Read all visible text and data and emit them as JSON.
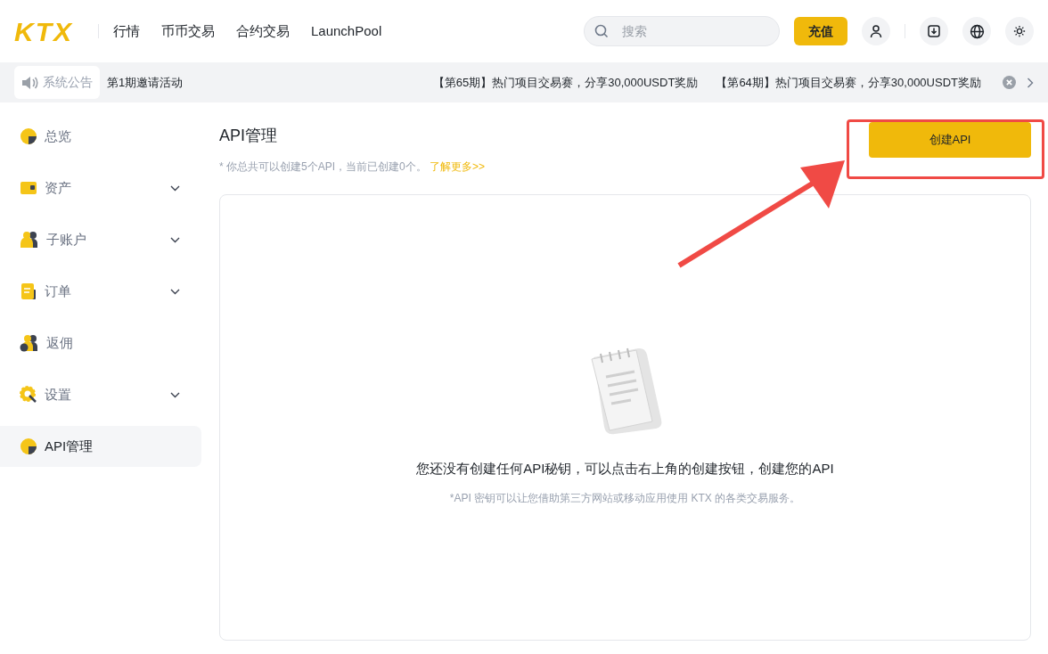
{
  "header": {
    "logo": "KTX",
    "nav": [
      "行情",
      "币币交易",
      "合约交易",
      "LaunchPool"
    ],
    "search": {
      "placeholder": "搜索"
    },
    "deposit_button": "充值"
  },
  "notice_bar": {
    "label": "系统公告",
    "first": "第1期邀请活动",
    "items": [
      "【第65期】热门项目交易赛，分享30,000USDT奖励",
      "【第64期】热门项目交易赛，分享30,000USDT奖励"
    ]
  },
  "sidebar": {
    "items": [
      {
        "label": "总览",
        "kind": "chart",
        "expandable": false,
        "selected": false
      },
      {
        "label": "资产",
        "kind": "wallet",
        "expandable": true,
        "selected": false
      },
      {
        "label": "子账户",
        "kind": "users",
        "expandable": true,
        "selected": false
      },
      {
        "label": "订单",
        "kind": "order",
        "expandable": true,
        "selected": false
      },
      {
        "label": "返佣",
        "kind": "rebate",
        "expandable": false,
        "selected": false
      },
      {
        "label": "设置",
        "kind": "settings",
        "expandable": true,
        "selected": false
      },
      {
        "label": "API管理",
        "kind": "chart",
        "expandable": false,
        "selected": true
      }
    ]
  },
  "main": {
    "title": "API管理",
    "note": "* 你总共可以创建5个API，当前已创建0个。",
    "note_link": "了解更多>>",
    "create_button": "创建API",
    "empty_state": {
      "title": "您还没有创建任何API秘钥，可以点击右上角的创建按钮，创建您的API",
      "subtitle": "*API 密钥可以让您借助第三方网站或移动应用使用 KTX 的各类交易服务。"
    }
  }
}
